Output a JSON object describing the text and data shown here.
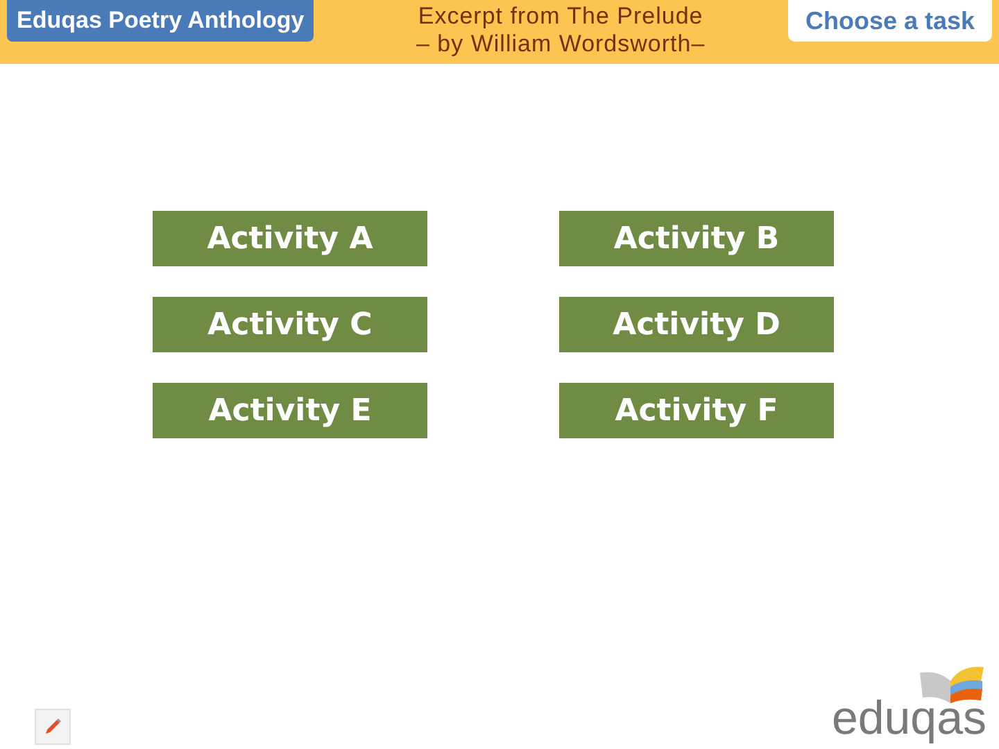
{
  "header": {
    "anthology_button": "Eduqas Poetry Anthology",
    "title_line_1": "Excerpt from The Prelude",
    "title_line_2": "– by William Wordsworth–",
    "task_button": "Choose a task"
  },
  "activities": [
    "Activity A",
    "Activity B",
    "Activity C",
    "Activity D",
    "Activity E",
    "Activity F"
  ],
  "logo": "eduqas"
}
